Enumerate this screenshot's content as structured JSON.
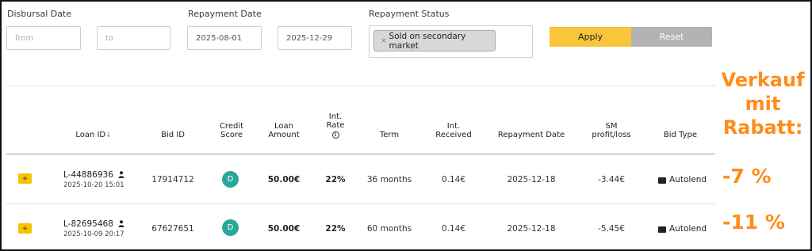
{
  "filters": {
    "disbursal_label": "Disbursal Date",
    "disbursal_from_placeholder": "from",
    "disbursal_to_placeholder": "to",
    "repayment_label": "Repayment Date",
    "repayment_from": "2025-08-01",
    "repayment_to": "2025-12-29",
    "status_label": "Repayment Status",
    "status_chip_remove": "×",
    "status_chip": "Sold on secondary market",
    "apply_label": "Apply",
    "reset_label": "Reset"
  },
  "table": {
    "headers": {
      "loan_id": "Loan ID",
      "loan_id_sort_arrow": "↓",
      "bid_id": "Bid ID",
      "credit_score_1": "Credit",
      "credit_score_2": "Score",
      "loan_amount_1": "Loan",
      "loan_amount_2": "Amount",
      "int_rate_1": "Int.",
      "int_rate_2": "Rate",
      "term": "Term",
      "int_received_1": "Int.",
      "int_received_2": "Received",
      "repayment_date": "Repayment Date",
      "sm_1": "SM",
      "sm_2": "profit/loss",
      "bid_type": "Bid Type"
    },
    "rows": [
      {
        "expand": "+",
        "loan_id": "L-44886936",
        "loan_date": "2025-10-20 15:01",
        "bid_id": "17914712",
        "credit_score": "D",
        "loan_amount": "50.00€",
        "int_rate": "22%",
        "term": "36 months",
        "int_received": "0.14€",
        "repayment_date": "2025-12-18",
        "sm_profit_loss": "-3.44€",
        "bid_type": "Autolend"
      },
      {
        "expand": "+",
        "loan_id": "L-82695468",
        "loan_date": "2025-10-09 20:17",
        "bid_id": "67627651",
        "credit_score": "D",
        "loan_amount": "50.00€",
        "int_rate": "22%",
        "term": "60 months",
        "int_received": "0.14€",
        "repayment_date": "2025-12-18",
        "sm_profit_loss": "-5.45€",
        "bid_type": "Autolend"
      }
    ]
  },
  "annotation": {
    "headline_1": "Verkauf",
    "headline_2": "mit",
    "headline_3": "Rabatt:",
    "row1_discount": "-7 %",
    "row2_discount": "-11 %"
  },
  "colors": {
    "accent_yellow": "#f9c53a",
    "score_teal": "#2aa79b",
    "annotation_orange": "#ff8c1a",
    "reset_gray": "#b3b3b3"
  }
}
